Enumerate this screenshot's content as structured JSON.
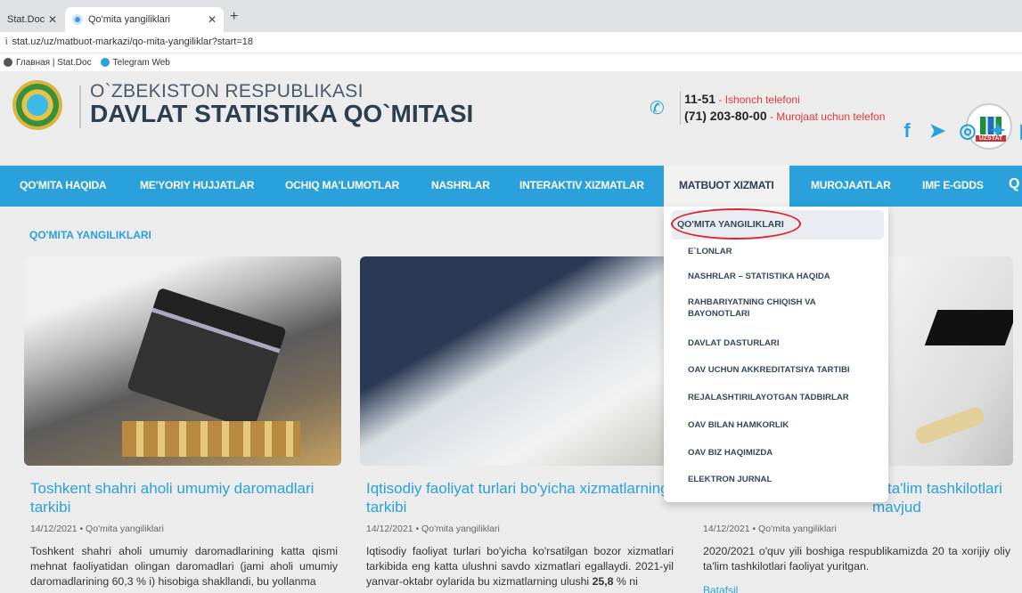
{
  "browser": {
    "tab_inactive": "Stat.Doc",
    "tab_active": "Qo'mita yangiliklari",
    "url": "stat.uz/uz/matbuot-markazi/qo-mita-yangiliklar?start=18",
    "bookmarks": [
      "Главная | Stat.Doc",
      "Telegram Web"
    ]
  },
  "header": {
    "title_line1": "O`ZBEKISTON RESPUBLIKASI",
    "title_line2": "DAVLAT STATISTIKA QO`MITASI",
    "phone1_number": "11-51",
    "phone1_label": " - Ishonch telefoni",
    "phone2_number": "(71) 203-80-00",
    "phone2_label": " - Murojaat uchun telefon",
    "logo_label": "UZSTAT"
  },
  "nav": [
    "QO'MITA HAQIDA",
    "ME'YORIY HUJJATLAR",
    "OCHIQ MA'LUMOTLAR",
    "NASHRLAR",
    "INTERAKTIV XIZMATLAR",
    "MATBUOT XIZMATI",
    "MUROJAATLAR",
    "IMF E-GDDS"
  ],
  "section_title": "QO'MITA YANGILIKLARI",
  "dropdown": [
    "QO'MITA YANGILIKLARI",
    "E`LONLAR",
    "NASHRLAR – STATISTIKA HAQIDA",
    "RAHBARIYATNING CHIQISH VA BAYONOTLARI",
    "DAVLAT DASTURLARI",
    "OAV UCHUN AKKREDITATSIYA TARTIBI",
    "REJALASHTIRILAYOTGAN TADBIRLAR",
    "OAV BILAN HAMKORLIK",
    "OAV BIZ HAQIMIZDA",
    "ELEKTRON JURNAL"
  ],
  "cards": [
    {
      "title": "Toshkent shahri aholi umumiy daromadlari tarkibi",
      "meta": "14/12/2021 • Qo'mita yangiliklari",
      "text": "Toshkent shahri aholi umumiy daromadlarining katta qismi mehnat faoliyatidan olingan daromadlari (jami aholi umumiy daromadlarining 60,3 % i) hisobiga shakllandi, bu yollanma"
    },
    {
      "title": "Iqtisodiy faoliyat turlari bo'yicha xizmatlarning tarkibi",
      "meta": "14/12/2021 • Qo'mita yangiliklari",
      "text_a": "Iqtisodiy faoliyat turlari bo'yicha ko'rsatilgan bozor xizmatlari tarkibida eng katta ulushni savdo xizmatlari egallaydi. 2021-yil yanvar-oktabr oylarida bu xizmatlarning ulushi ",
      "text_b": "25,8",
      "text_c": " % ni"
    },
    {
      "title": "iy ta'lim tashkilotlari mavjud",
      "meta": "14/12/2021 • Qo'mita yangiliklari",
      "text": "2020/2021 o'quv yili boshiga respublikamizda 20 ta xorijiy oliy ta'lim tashkilotlari faoliyat yuritgan.",
      "more": "Batafsil"
    }
  ],
  "icons": {
    "phone": "phone-icon",
    "socials": [
      "facebook-icon",
      "telegram-icon",
      "instagram-icon",
      "twitter-icon",
      "youtube-icon"
    ],
    "search": "search-icon"
  },
  "colors": {
    "accent": "#2aa1da",
    "highlight_ring": "#e0232e",
    "phone_label": "#e53935"
  }
}
